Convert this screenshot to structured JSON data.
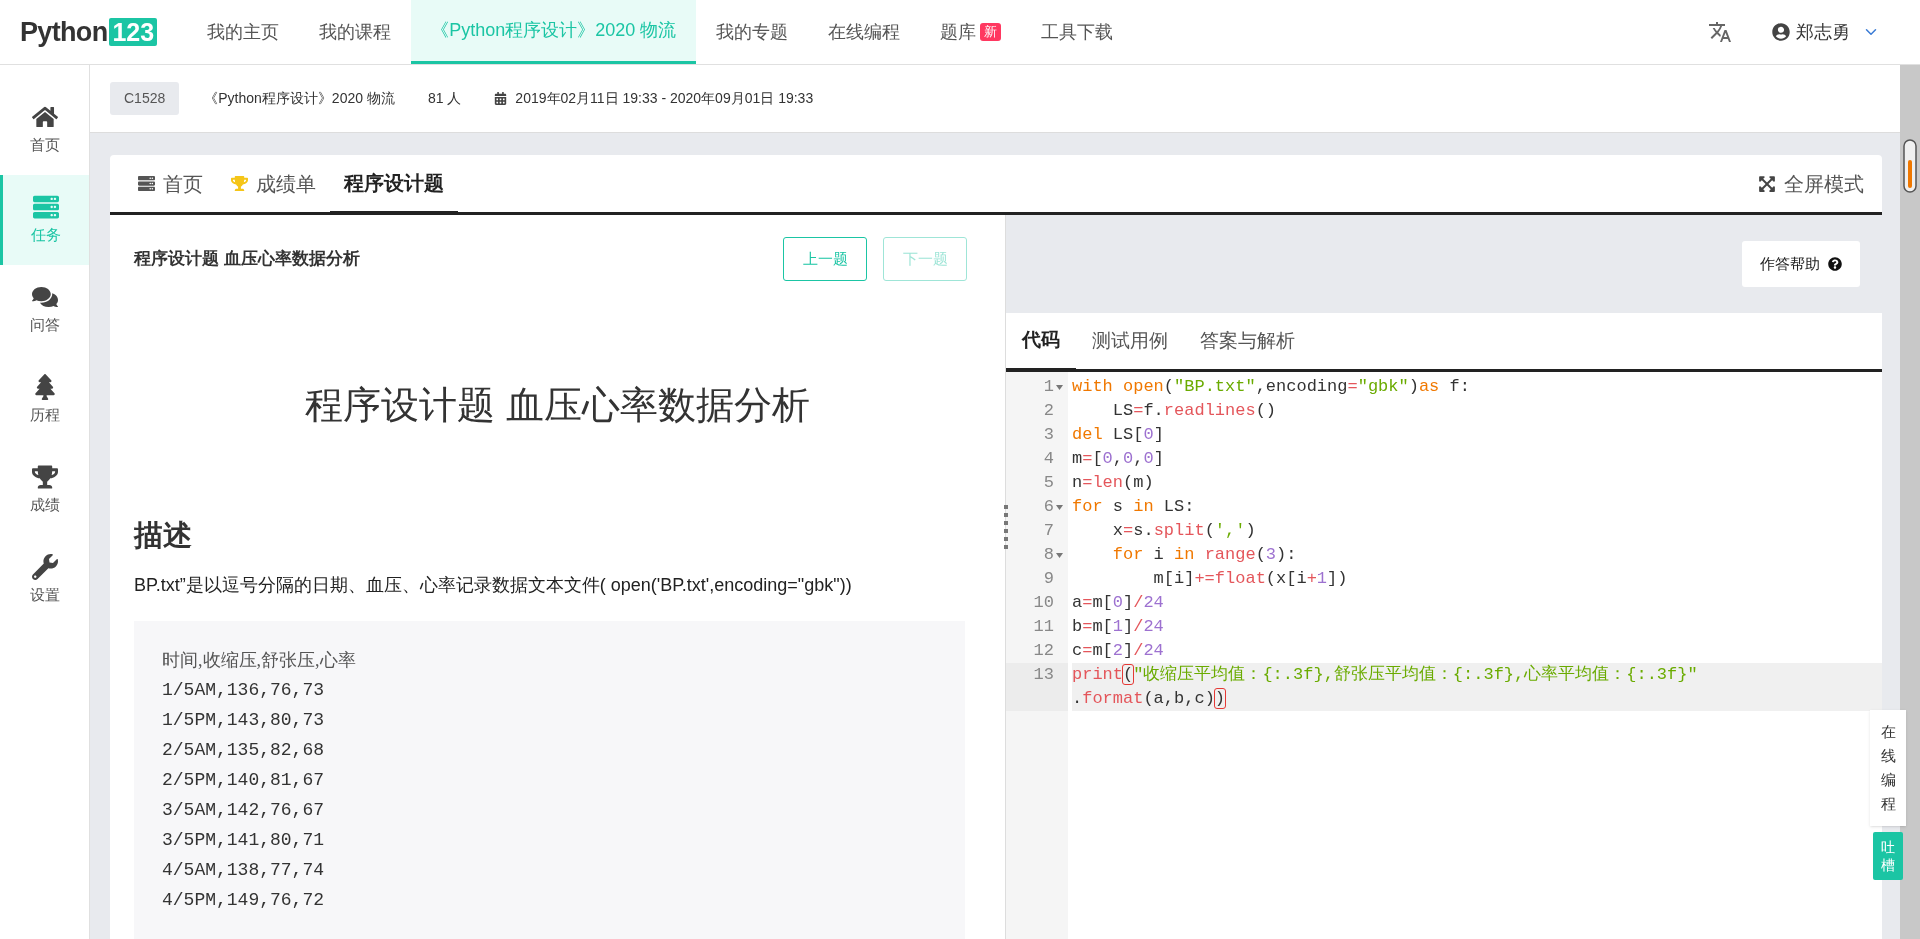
{
  "logo": {
    "text": "Python",
    "badge": "123"
  },
  "nav": [
    {
      "label": "我的主页",
      "selected": false
    },
    {
      "label": "我的课程",
      "selected": false
    },
    {
      "label": "《Python程序设计》2020 物流",
      "selected": true
    },
    {
      "label": "我的专题",
      "selected": false
    },
    {
      "label": "在线编程",
      "selected": false
    },
    {
      "label": "题库",
      "selected": false,
      "badge": "新"
    },
    {
      "label": "工具下载",
      "selected": false
    }
  ],
  "user": {
    "name": "郑志勇"
  },
  "sidebar": [
    {
      "label": "首页",
      "kind": "home",
      "selected": false
    },
    {
      "label": "任务",
      "kind": "tasks",
      "selected": true
    },
    {
      "label": "问答",
      "kind": "qa",
      "selected": false
    },
    {
      "label": "历程",
      "kind": "history",
      "selected": false
    },
    {
      "label": "成绩",
      "kind": "grades",
      "selected": false
    },
    {
      "label": "设置",
      "kind": "settings",
      "selected": false
    }
  ],
  "course_bar": {
    "code": "C1528",
    "name": "《Python程序设计》2020 物流",
    "members": "81 人",
    "period": "2019年02月11日 19:33 - 2020年09月01日 19:33"
  },
  "tabs": [
    {
      "label": "首页",
      "kind": "home",
      "selected": false
    },
    {
      "label": "成绩单",
      "kind": "grades",
      "selected": false
    },
    {
      "label": "程序设计题",
      "kind": "plain",
      "selected": true
    }
  ],
  "fullscreen": "全屏模式",
  "problem": {
    "header": "程序设计题 血压心率数据分析",
    "buttons": [
      {
        "label": "上一题",
        "disabled": false
      },
      {
        "label": "下一题",
        "disabled": true
      }
    ],
    "title": "程序设计题 血压心率数据分析",
    "section": "描述",
    "description": "BP.txt”是以逗号分隔的日期、血压、心率记录数据文本文件( open('BP.txt',encoding=\"gbk\"))",
    "data_block": [
      "时间,收缩压,舒张压,心率",
      "1/5AM,136,76,73",
      "1/5PM,143,80,73",
      "2/5AM,135,82,68",
      "2/5PM,140,81,67",
      "3/5AM,142,76,67",
      "3/5PM,141,80,71",
      "4/5AM,138,77,74",
      "4/5PM,149,76,72"
    ]
  },
  "editor": {
    "help": "作答帮助",
    "tabs": [
      {
        "label": "代码",
        "selected": true
      },
      {
        "label": "测试用例",
        "selected": false
      },
      {
        "label": "答案与解析",
        "selected": false
      }
    ],
    "lines": [
      {
        "number": "1",
        "foldable": true,
        "active": false,
        "tokens": [
          {
            "kind": "kw",
            "text": "with open"
          },
          {
            "kind": "plain",
            "text": "("
          },
          {
            "kind": "str",
            "text": "\"BP.txt\""
          },
          {
            "kind": "plain",
            "text": ",encoding"
          },
          {
            "kind": "op",
            "text": "="
          },
          {
            "kind": "str",
            "text": "\"gbk\""
          },
          {
            "kind": "plain",
            "text": ")"
          },
          {
            "kind": "kw",
            "text": "as"
          },
          {
            "kind": "plain",
            "text": " f:"
          }
        ]
      },
      {
        "number": "2",
        "foldable": false,
        "active": false,
        "tokens": [
          {
            "kind": "plain",
            "text": "    LS"
          },
          {
            "kind": "op",
            "text": "="
          },
          {
            "kind": "plain",
            "text": "f."
          },
          {
            "kind": "fn",
            "text": "readlines"
          },
          {
            "kind": "plain",
            "text": "()"
          }
        ]
      },
      {
        "number": "3",
        "foldable": false,
        "active": false,
        "tokens": [
          {
            "kind": "kw",
            "text": "del"
          },
          {
            "kind": "plain",
            "text": " LS["
          },
          {
            "kind": "num",
            "text": "0"
          },
          {
            "kind": "plain",
            "text": "]"
          }
        ]
      },
      {
        "number": "4",
        "foldable": false,
        "active": false,
        "tokens": [
          {
            "kind": "plain",
            "text": "m"
          },
          {
            "kind": "op",
            "text": "="
          },
          {
            "kind": "plain",
            "text": "["
          },
          {
            "kind": "num",
            "text": "0"
          },
          {
            "kind": "plain",
            "text": ","
          },
          {
            "kind": "num",
            "text": "0"
          },
          {
            "kind": "plain",
            "text": ","
          },
          {
            "kind": "num",
            "text": "0"
          },
          {
            "kind": "plain",
            "text": "]"
          }
        ]
      },
      {
        "number": "5",
        "foldable": false,
        "active": false,
        "tokens": [
          {
            "kind": "plain",
            "text": "n"
          },
          {
            "kind": "op",
            "text": "="
          },
          {
            "kind": "fn",
            "text": "len"
          },
          {
            "kind": "plain",
            "text": "(m)"
          }
        ]
      },
      {
        "number": "6",
        "foldable": true,
        "active": false,
        "tokens": [
          {
            "kind": "kw",
            "text": "for"
          },
          {
            "kind": "plain",
            "text": " s "
          },
          {
            "kind": "kw",
            "text": "in"
          },
          {
            "kind": "plain",
            "text": " LS:"
          }
        ]
      },
      {
        "number": "7",
        "foldable": false,
        "active": false,
        "tokens": [
          {
            "kind": "plain",
            "text": "    x"
          },
          {
            "kind": "op",
            "text": "="
          },
          {
            "kind": "plain",
            "text": "s."
          },
          {
            "kind": "fn",
            "text": "split"
          },
          {
            "kind": "plain",
            "text": "("
          },
          {
            "kind": "str",
            "text": "','"
          },
          {
            "kind": "plain",
            "text": ")"
          }
        ]
      },
      {
        "number": "8",
        "foldable": true,
        "active": false,
        "tokens": [
          {
            "kind": "kw",
            "text": "    for"
          },
          {
            "kind": "plain",
            "text": " i "
          },
          {
            "kind": "kw",
            "text": "in "
          },
          {
            "kind": "fn",
            "text": "range"
          },
          {
            "kind": "plain",
            "text": "("
          },
          {
            "kind": "num",
            "text": "3"
          },
          {
            "kind": "plain",
            "text": "):"
          }
        ]
      },
      {
        "number": "9",
        "foldable": false,
        "active": false,
        "tokens": [
          {
            "kind": "plain",
            "text": "        m[i]"
          },
          {
            "kind": "op",
            "text": "+="
          },
          {
            "kind": "fn",
            "text": "float"
          },
          {
            "kind": "plain",
            "text": "(x[i"
          },
          {
            "kind": "op",
            "text": "+"
          },
          {
            "kind": "num",
            "text": "1"
          },
          {
            "kind": "plain",
            "text": "])"
          }
        ]
      },
      {
        "number": "10",
        "foldable": false,
        "active": false,
        "tokens": [
          {
            "kind": "plain",
            "text": "a"
          },
          {
            "kind": "op",
            "text": "="
          },
          {
            "kind": "plain",
            "text": "m["
          },
          {
            "kind": "num",
            "text": "0"
          },
          {
            "kind": "plain",
            "text": "]"
          },
          {
            "kind": "op",
            "text": "/"
          },
          {
            "kind": "num",
            "text": "24"
          }
        ]
      },
      {
        "number": "11",
        "foldable": false,
        "active": false,
        "tokens": [
          {
            "kind": "plain",
            "text": "b"
          },
          {
            "kind": "op",
            "text": "="
          },
          {
            "kind": "plain",
            "text": "m["
          },
          {
            "kind": "num",
            "text": "1"
          },
          {
            "kind": "plain",
            "text": "]"
          },
          {
            "kind": "op",
            "text": "/"
          },
          {
            "kind": "num",
            "text": "24"
          }
        ]
      },
      {
        "number": "12",
        "foldable": false,
        "active": false,
        "tokens": [
          {
            "kind": "plain",
            "text": "c"
          },
          {
            "kind": "op",
            "text": "="
          },
          {
            "kind": "plain",
            "text": "m["
          },
          {
            "kind": "num",
            "text": "2"
          },
          {
            "kind": "plain",
            "text": "]"
          },
          {
            "kind": "op",
            "text": "/"
          },
          {
            "kind": "num",
            "text": "24"
          }
        ]
      },
      {
        "number": "13",
        "foldable": false,
        "active": true,
        "tokens": [
          {
            "kind": "fn",
            "text": "print"
          },
          {
            "kind": "bracket",
            "text": "("
          },
          {
            "kind": "str",
            "text": "\"收缩压平均值：{:.3f},舒张压平均值：{:.3f},心率平均值：{:.3f}\""
          }
        ],
        "wrap": [
          {
            "kind": "plain",
            "text": "."
          },
          {
            "kind": "fn",
            "text": "format"
          },
          {
            "kind": "plain",
            "text": "(a,b,c)"
          },
          {
            "kind": "bracket",
            "text": ")"
          }
        ]
      }
    ]
  },
  "float_panel": {
    "label": "在线编程",
    "feedback": "吐槽"
  }
}
